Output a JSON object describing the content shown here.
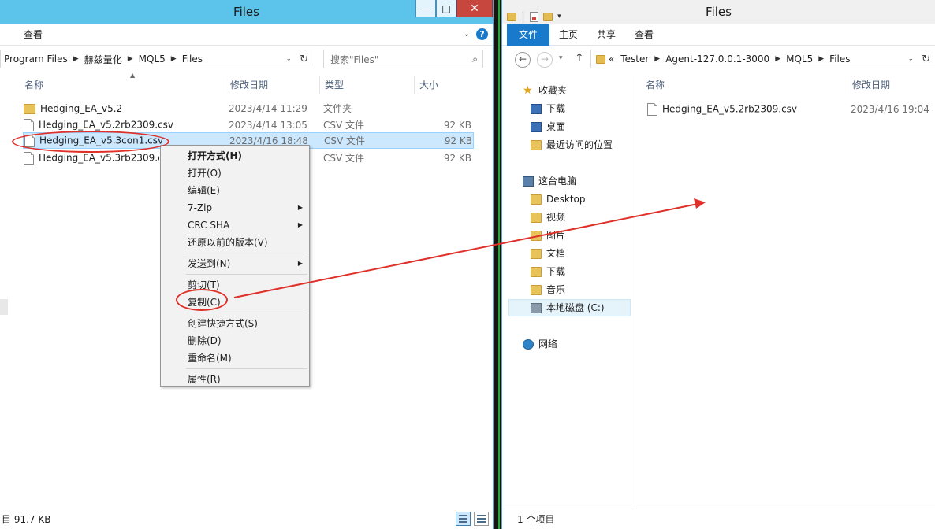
{
  "left_window": {
    "title": "Files",
    "ribbon_tab": "查看",
    "breadcrumb": [
      "Program Files",
      "赫兹量化",
      "MQL5",
      "Files"
    ],
    "search_placeholder": "搜索\"Files\"",
    "columns": [
      "名称",
      "修改日期",
      "类型",
      "大小"
    ],
    "files": [
      {
        "name": "Hedging_EA_v5.2",
        "date": "2023/4/14 11:29",
        "type": "文件夹",
        "size": "",
        "kind": "folder"
      },
      {
        "name": "Hedging_EA_v5.2rb2309.csv",
        "date": "2023/4/14 13:05",
        "type": "CSV 文件",
        "size": "92 KB",
        "kind": "file"
      },
      {
        "name": "Hedging_EA_v5.3con1.csv",
        "date": "2023/4/16 18:48",
        "type": "CSV 文件",
        "size": "92 KB",
        "kind": "file",
        "selected": true
      },
      {
        "name": "Hedging_EA_v5.3rb2309.csv",
        "date": "",
        "type": "CSV 文件",
        "size": "92 KB",
        "kind": "file"
      }
    ],
    "status_text": "目  91.7 KB"
  },
  "context_menu": {
    "items": [
      {
        "label": "打开方式(H)",
        "bold": true
      },
      {
        "label": "打开(O)"
      },
      {
        "label": "编辑(E)"
      },
      {
        "label": "7-Zip",
        "submenu": true
      },
      {
        "label": "CRC SHA",
        "submenu": true
      },
      {
        "label": "还原以前的版本(V)"
      },
      {
        "separator": true
      },
      {
        "label": "发送到(N)",
        "submenu": true
      },
      {
        "separator": true
      },
      {
        "label": "剪切(T)"
      },
      {
        "label": "复制(C)"
      },
      {
        "separator": true
      },
      {
        "label": "创建快捷方式(S)"
      },
      {
        "label": "删除(D)"
      },
      {
        "label": "重命名(M)"
      },
      {
        "separator": true
      },
      {
        "label": "属性(R)"
      }
    ]
  },
  "right_window": {
    "title": "Files",
    "ribbon_tabs": [
      "文件",
      "主页",
      "共享",
      "查看"
    ],
    "breadcrumb_prefix": "«",
    "breadcrumb": [
      "Tester",
      "Agent-127.0.0.1-3000",
      "MQL5",
      "Files"
    ],
    "columns": [
      "名称",
      "修改日期"
    ],
    "nav": {
      "favorites_header": "收藏夹",
      "favorites": [
        "下载",
        "桌面",
        "最近访问的位置"
      ],
      "pc_header": "这台电脑",
      "pc_items": [
        "Desktop",
        "视频",
        "图片",
        "文档",
        "下载",
        "音乐",
        "本地磁盘 (C:)"
      ],
      "network": "网络"
    },
    "files": [
      {
        "name": "Hedging_EA_v5.2rb2309.csv",
        "date": "2023/4/16 19:04"
      }
    ],
    "status_text": "1 个项目"
  },
  "annotation_color": "#e0302a"
}
